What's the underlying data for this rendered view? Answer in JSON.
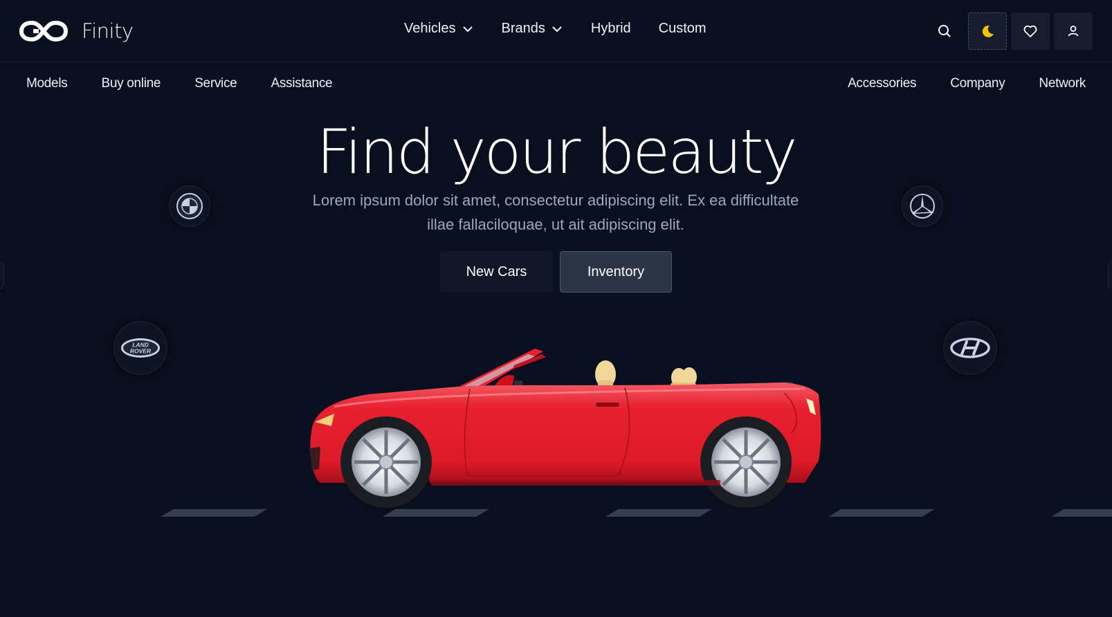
{
  "header": {
    "brand_name": "Finity",
    "logo_icon": "infinity-logo",
    "nav": [
      {
        "label": "Vehicles",
        "has_dropdown": true
      },
      {
        "label": "Brands",
        "has_dropdown": true
      },
      {
        "label": "Hybrid",
        "has_dropdown": false
      },
      {
        "label": "Custom",
        "has_dropdown": false
      }
    ],
    "actions": [
      "search-icon",
      "moon-icon",
      "heart-icon",
      "user-icon"
    ],
    "theme_icon_color": "#f5c400"
  },
  "subnav": {
    "left": [
      "Models",
      "Buy online",
      "Service",
      "Assistance"
    ],
    "right": [
      "Accessories",
      "Company",
      "Network"
    ]
  },
  "hero": {
    "title": "Find your beauty",
    "subtitle": "Lorem ipsum dolor sit amet, consectetur adipiscing elit. Ex ea difficultate illae fallaciloquae, ut ait adipiscing elit.",
    "buttons": {
      "new_cars": "New Cars",
      "inventory": "Inventory"
    }
  },
  "brands": {
    "bmw": {
      "icon": "bmw-logo"
    },
    "mercedes": {
      "icon": "mercedes-logo"
    },
    "land_rover": {
      "icon": "land-rover-logo",
      "text_line1": "LAND",
      "text_line2": "ROVER"
    },
    "hyundai": {
      "icon": "hyundai-logo"
    }
  },
  "car": {
    "icon": "red-convertible-car",
    "color": "#e8202f"
  },
  "colors": {
    "background": "#0a0f1f",
    "accent_red": "#e8202f",
    "muted_text": "#9aa8c2"
  }
}
